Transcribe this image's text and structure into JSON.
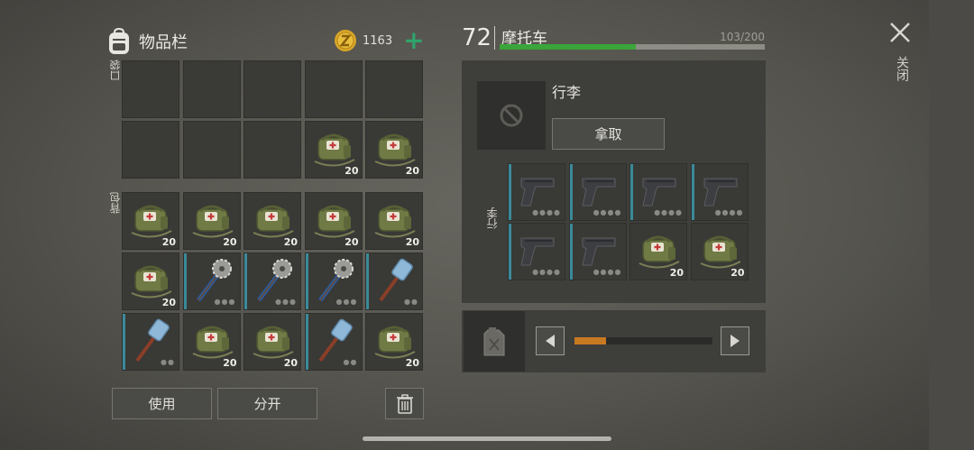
{
  "inventory": {
    "title": "物品栏",
    "coins": "1163",
    "add_coin_symbol": "+",
    "pocket_label": "口袋",
    "backpack_label": "背包",
    "pocket_slots": [
      {
        "item": "",
        "count": ""
      },
      {
        "item": "",
        "count": ""
      },
      {
        "item": "",
        "count": ""
      },
      {
        "item": "",
        "count": ""
      },
      {
        "item": "",
        "count": ""
      },
      {
        "item": "",
        "count": ""
      },
      {
        "item": "",
        "count": ""
      },
      {
        "item": "",
        "count": ""
      },
      {
        "item": "medkit-bag",
        "count": "20"
      },
      {
        "item": "medkit-bag",
        "count": "20"
      }
    ],
    "backpack_slots": [
      {
        "item": "medkit-bag",
        "count": "20"
      },
      {
        "item": "medkit-bag",
        "count": "20"
      },
      {
        "item": "medkit-bag",
        "count": "20"
      },
      {
        "item": "medkit-bag",
        "count": "20"
      },
      {
        "item": "medkit-bag",
        "count": "20"
      },
      {
        "item": "medkit-bag",
        "count": "20"
      },
      {
        "item": "saw-mace",
        "count": ""
      },
      {
        "item": "saw-mace",
        "count": ""
      },
      {
        "item": "saw-mace",
        "count": ""
      },
      {
        "item": "sledgehammer",
        "count": ""
      },
      {
        "item": "sledgehammer",
        "count": ""
      },
      {
        "item": "medkit-bag",
        "count": "20"
      },
      {
        "item": "medkit-bag",
        "count": "20"
      },
      {
        "item": "sledgehammer",
        "count": ""
      },
      {
        "item": "medkit-bag",
        "count": "20"
      }
    ],
    "use_label": "使用",
    "split_label": "分开"
  },
  "vehicle": {
    "capacity": "72",
    "name": "摩托车",
    "load": "103/200",
    "load_fraction": 0.515,
    "trunk_title": "行李",
    "take_label": "拿取",
    "trunk_side_label": "行李",
    "trunk_slots": [
      {
        "item": "pistol",
        "count": ""
      },
      {
        "item": "pistol",
        "count": ""
      },
      {
        "item": "pistol",
        "count": ""
      },
      {
        "item": "pistol",
        "count": ""
      },
      {
        "item": "pistol",
        "count": ""
      },
      {
        "item": "pistol",
        "count": ""
      },
      {
        "item": "medkit-bag",
        "count": "20"
      },
      {
        "item": "medkit-bag",
        "count": "20"
      }
    ],
    "fuel_fraction": 0.23
  },
  "close_label": "关闭",
  "colors": {
    "accent_green": "#2fa36b",
    "load_green": "#3aa53a",
    "fuel_orange": "#c77a22",
    "slot_stripe": "#3a8a9a"
  },
  "icons": [
    "backpack-icon",
    "coin-icon",
    "plus-icon",
    "no-entry-icon",
    "fuel-can-icon",
    "trash-icon",
    "close-icon",
    "arrow-left-icon",
    "arrow-right-icon"
  ]
}
